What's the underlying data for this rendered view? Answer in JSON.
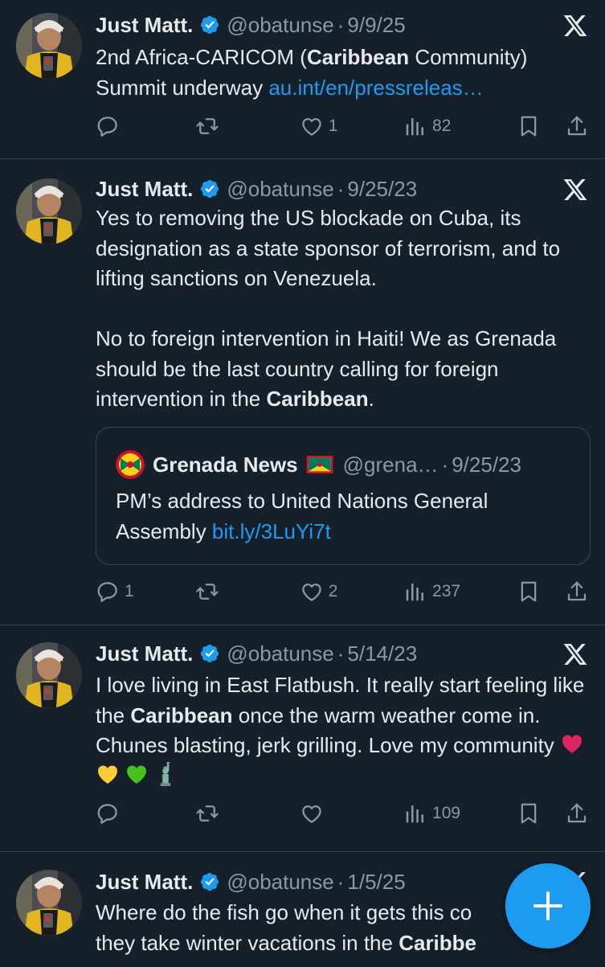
{
  "colors": {
    "background": "#15202b",
    "accent": "#1d9bf0",
    "muted": "#8b98a5",
    "verified": "#1d9bf0"
  },
  "tweets": [
    {
      "name": "Just Matt.",
      "handle": "@obatunse",
      "dot": "·",
      "date": "9/9/25",
      "text": {
        "a": "2nd Africa-CARICOM (",
        "b": "Caribbean",
        "c": " Community)",
        "d": "Summit underway ",
        "link": "au.int/en/pressreleas…"
      },
      "stats": {
        "replies": "",
        "reposts": "",
        "likes": "1",
        "views": "82"
      }
    },
    {
      "name": "Just Matt.",
      "handle": "@obatunse",
      "dot": "·",
      "date": "9/25/23",
      "text": {
        "p1": "Yes to removing the US blockade on Cuba, its designation as a state sponsor of terrorism, and to lifting sanctions on Venezuela.",
        "p2a": "No to foreign intervention in Haiti! We as Grenada should be the last country calling for foreign intervention in the ",
        "p2b": "Caribbean",
        "p2c": "."
      },
      "quote": {
        "name": "Grenada News",
        "flag_icon": "grenada-flag-icon",
        "handle": "@grena…",
        "dot": "·",
        "date": "9/25/23",
        "text": "PM’s address to United Nations General Assembly ",
        "link": "bit.ly/3LuYi7t"
      },
      "stats": {
        "replies": "1",
        "reposts": "",
        "likes": "2",
        "views": "237"
      }
    },
    {
      "name": "Just Matt.",
      "handle": "@obatunse",
      "dot": "·",
      "date": "5/14/23",
      "text": {
        "a": "I love living in East Flatbush. It really start feeling like the ",
        "b": "Caribbean",
        "c": " once the warm weather come in. Chunes blasting, jerk grilling. Love my community "
      },
      "emojis": [
        "red-heart-icon",
        "yellow-heart-icon",
        "green-heart-icon",
        "statue-of-liberty-icon"
      ],
      "stats": {
        "replies": "",
        "reposts": "",
        "likes": "",
        "views": "109"
      }
    },
    {
      "name": "Just Matt.",
      "handle": "@obatunse",
      "dot": "·",
      "date": "1/5/25",
      "text": {
        "a": "Where do the fish go when it gets this co",
        "b": "they take winter vacations in the ",
        "c": "Caribbe"
      }
    }
  ],
  "fab": {
    "icon": "plus-icon"
  }
}
